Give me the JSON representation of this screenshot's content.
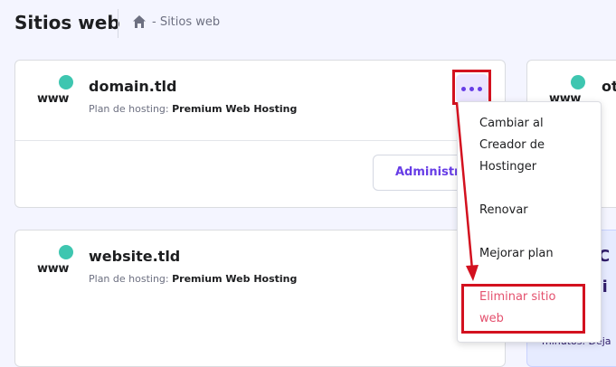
{
  "header": {
    "title": "Sitios web",
    "breadcrumb": "- Sitios web"
  },
  "sites": [
    {
      "logo_text": "www",
      "name": "domain.tld",
      "plan_label": "Plan de hosting:",
      "plan_value": "Premium Web Hosting",
      "manage_label": "Administrar"
    },
    {
      "logo_text": "www",
      "name": "website.tld",
      "plan_label": "Plan de hosting:",
      "plan_value": "Premium Web Hosting"
    }
  ],
  "menu": {
    "items": [
      "Cambiar al",
      "Creador de",
      "Hostinger",
      "Renovar",
      "Mejorar plan",
      "Eliminar sitio",
      "web"
    ]
  },
  "right_card": {
    "logo_text": "www",
    "name_partial": "ot"
  },
  "promo": {
    "line1": "C",
    "line2": "ci",
    "line3": "minutos. Deja"
  },
  "colors": {
    "accent": "#673de6",
    "danger": "#e4516e",
    "highlight": "#d3111f",
    "status_dot": "#3ec6b0"
  }
}
